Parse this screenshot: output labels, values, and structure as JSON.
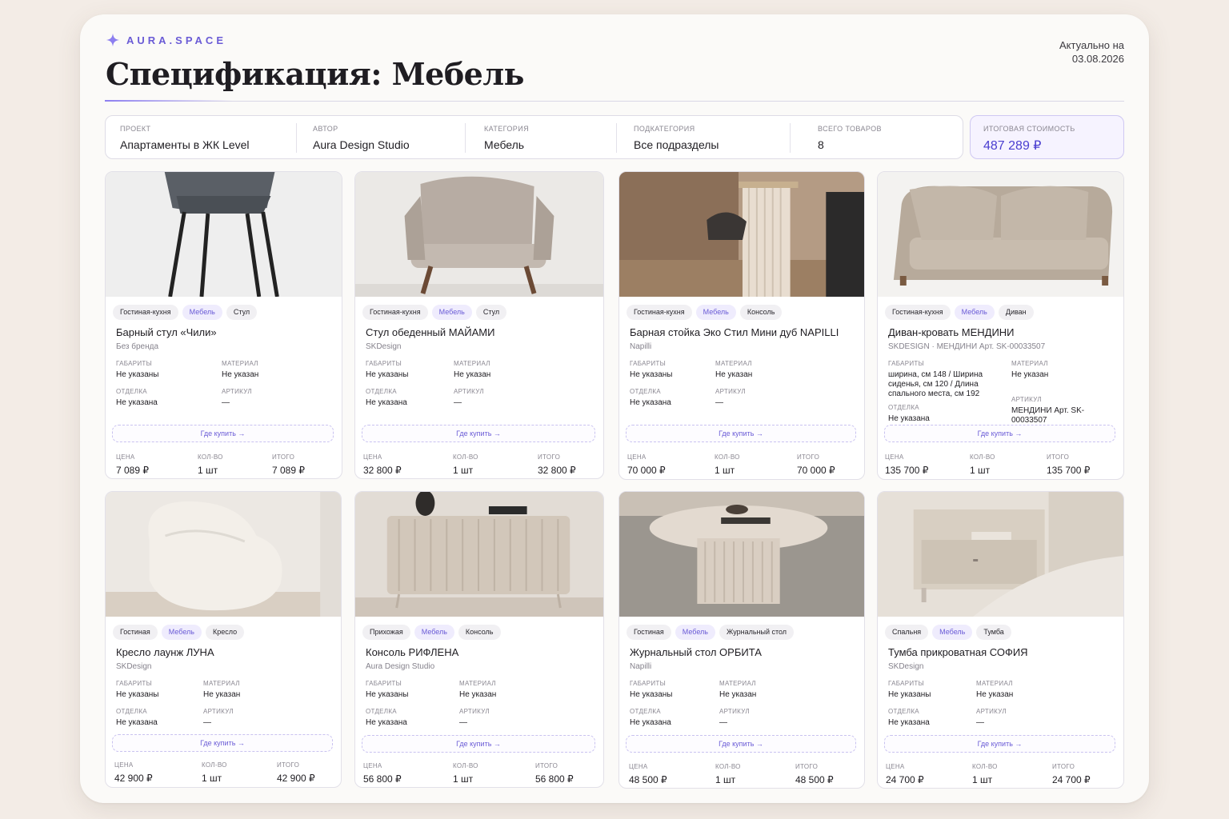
{
  "brand": {
    "name": "AURA.SPACE",
    "icon": "sparkle-icon"
  },
  "title": "Спецификация: Мебель",
  "actual": {
    "label": "Актуально на",
    "date": "03.08.2026"
  },
  "meta": [
    {
      "label": "Проект",
      "value": "Апартаменты в ЖК Level"
    },
    {
      "label": "Автор",
      "value": "Aura Design Studio"
    },
    {
      "label": "Категория",
      "value": "Мебель"
    },
    {
      "label": "Подкатегория",
      "value": "Все подразделы"
    },
    {
      "label": "Всего товаров",
      "value": "8"
    }
  ],
  "total": {
    "label": "Итоговая стоимость",
    "value": "487 289 ₽"
  },
  "labels": {
    "dims": "Габариты",
    "material": "Материал",
    "finish": "Отделка",
    "article": "Артикул",
    "buy": "Где купить →",
    "price": "Цена",
    "qty": "Кол-во",
    "sum": "Итого"
  },
  "colors": {
    "accent": "#6a5bd6",
    "accent_bg": "#efecfd",
    "sheet_bg": "#fbfaf8",
    "page_bg": "#f3ece6"
  },
  "products": [
    {
      "tags": [
        "Гостиная-кухня",
        "Мебель",
        "Стул"
      ],
      "name": "Барный стул «Чили»",
      "brand": "Без бренда",
      "dims": "Не указаны",
      "material": "Не указан",
      "finish": "Не указана",
      "article": "—",
      "price": "7 089 ₽",
      "qty": "1 шт",
      "sum": "7 089 ₽"
    },
    {
      "tags": [
        "Гостиная-кухня",
        "Мебель",
        "Стул"
      ],
      "name": "Стул обеденный МАЙАМИ",
      "brand": "SKDesign",
      "dims": "Не указаны",
      "material": "Не указан",
      "finish": "Не указана",
      "article": "—",
      "price": "32 800 ₽",
      "qty": "1 шт",
      "sum": "32 800 ₽"
    },
    {
      "tags": [
        "Гостиная-кухня",
        "Мебель",
        "Консоль"
      ],
      "name": "Барная стойка Эко Стил Мини дуб NAPILLI",
      "brand": "Napilli",
      "dims": "Не указаны",
      "material": "Не указан",
      "finish": "Не указана",
      "article": "—",
      "price": "70 000 ₽",
      "qty": "1 шт",
      "sum": "70 000 ₽"
    },
    {
      "tags": [
        "Гостиная-кухня",
        "Мебель",
        "Диван"
      ],
      "name": "Диван-кровать МЕНДИНИ",
      "brand": "SKDESIGN · МЕНДИНИ Арт. SK-00033507",
      "dims": "ширина, см 148 / Ширина сиденья, см 120 / Длина спального места, см  192",
      "material": "Не указан",
      "finish": "Не указана",
      "article": "МЕНДИНИ Арт. SK-00033507",
      "price": "135 700 ₽",
      "qty": "1 шт",
      "sum": "135 700 ₽"
    },
    {
      "tags": [
        "Гостиная",
        "Мебель",
        "Кресло"
      ],
      "name": "Кресло лаунж ЛУНА",
      "brand": "SKDesign",
      "dims": "Не указаны",
      "material": "Не указан",
      "finish": "Не указана",
      "article": "—",
      "price": "42 900 ₽",
      "qty": "1 шт",
      "sum": "42 900 ₽"
    },
    {
      "tags": [
        "Прихожая",
        "Мебель",
        "Консоль"
      ],
      "name": "Консоль РИФЛЕНА",
      "brand": "Aura Design Studio",
      "dims": "Не указаны",
      "material": "Не указан",
      "finish": "Не указана",
      "article": "—",
      "price": "56 800 ₽",
      "qty": "1 шт",
      "sum": "56 800 ₽"
    },
    {
      "tags": [
        "Гостиная",
        "Мебель",
        "Журнальный стол"
      ],
      "name": "Журнальный стол ОРБИТА",
      "brand": "Napilli",
      "dims": "Не указаны",
      "material": "Не указан",
      "finish": "Не указана",
      "article": "—",
      "price": "48 500 ₽",
      "qty": "1 шт",
      "sum": "48 500 ₽"
    },
    {
      "tags": [
        "Спальня",
        "Мебель",
        "Тумба"
      ],
      "name": "Тумба прикроватная СОФИЯ",
      "brand": "SKDesign",
      "dims": "Не указаны",
      "material": "Не указан",
      "finish": "Не указана",
      "article": "—",
      "price": "24 700 ₽",
      "qty": "1 шт",
      "sum": "24 700 ₽"
    }
  ]
}
